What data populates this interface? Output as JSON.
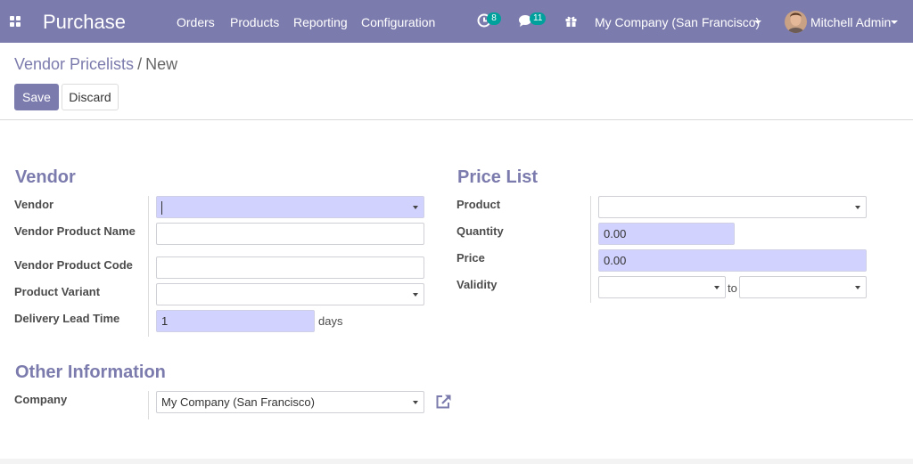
{
  "navbar": {
    "brand": "Purchase",
    "menu": [
      "Orders",
      "Products",
      "Reporting",
      "Configuration"
    ],
    "activity_count": "8",
    "messages_count": "11",
    "company": "My Company (San Francisco)",
    "user": "Mitchell Admin",
    "colors": {
      "bar": "#7c7bad",
      "badge": "#00a09d"
    }
  },
  "breadcrumb": {
    "parent": "Vendor Pricelists",
    "separator": "/",
    "current": "New"
  },
  "buttons": {
    "save": "Save",
    "discard": "Discard"
  },
  "vendor_section": {
    "title": "Vendor",
    "fields": {
      "vendor": {
        "label": "Vendor",
        "value": ""
      },
      "vendor_product_name": {
        "label": "Vendor Product Name",
        "value": ""
      },
      "vendor_product_code": {
        "label": "Vendor Product Code",
        "value": ""
      },
      "product_variant": {
        "label": "Product Variant",
        "value": ""
      },
      "delivery_lead_time": {
        "label": "Delivery Lead Time",
        "value": "1",
        "unit": "days"
      }
    }
  },
  "pricelist_section": {
    "title": "Price List",
    "fields": {
      "product": {
        "label": "Product",
        "value": ""
      },
      "quantity": {
        "label": "Quantity",
        "value": "0.00"
      },
      "price": {
        "label": "Price",
        "value": "0.00"
      },
      "validity": {
        "label": "Validity",
        "from": "",
        "to_label": "to",
        "to": ""
      }
    }
  },
  "other_section": {
    "title": "Other Information",
    "fields": {
      "company": {
        "label": "Company",
        "value": "My Company (San Francisco)"
      }
    }
  },
  "icons": [
    "apps-grid-icon",
    "activity-clock-icon",
    "chat-bubble-icon",
    "gift-icon",
    "caret-down-icon",
    "external-link-icon"
  ]
}
